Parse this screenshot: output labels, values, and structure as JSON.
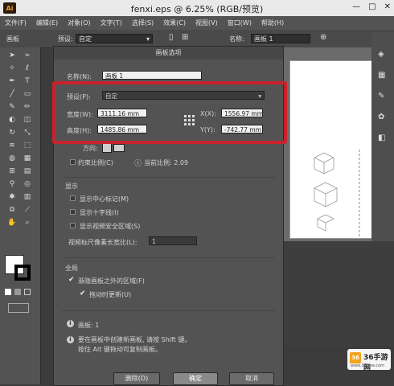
{
  "window": {
    "title": "fenxi.eps @ 6.25% (RGB/预览)",
    "app_logo": "Ai",
    "controls": [
      "—",
      "□",
      "✕"
    ]
  },
  "menu": [
    "文件(F)",
    "编辑(E)",
    "对象(O)",
    "文字(T)",
    "选择(S)",
    "效果(C)",
    "视图(V)",
    "窗口(W)",
    "帮助(H)"
  ],
  "control_bar": {
    "mode_label": "画板",
    "preset_label": "预设:",
    "preset_value": "自定",
    "name_label": "名称:",
    "name_value": "画板 1"
  },
  "dialog": {
    "title": "画板选项",
    "name_label": "名称(N):",
    "name_value": "画板 1",
    "preset_label": "预设(P):",
    "preset_value": "自定",
    "width_label": "宽度(W):",
    "width_value": "3111.16 mm",
    "height_label": "高度(H):",
    "height_value": "1485.86 mm",
    "x_label": "X(X):",
    "x_value": "1556.97 mm",
    "y_label": "Y(Y):",
    "y_value": "-742.77 mm",
    "orientation_label": "方向:",
    "constrain_label": "约束比例(C)",
    "current_ratio_label": "当前比例: 2.09",
    "display_section": "显示",
    "show_center": "显示中心标记(M)",
    "show_crosshairs": "显示十字线(I)",
    "show_video_safe": "显示视频安全区域(S)",
    "video_ruler_label": "视频标尺像素长宽比(L):",
    "video_ruler_value": "1",
    "global_section": "全局",
    "fade_outside": "渐隐画板之外的区域(F)",
    "update_drag": "拖动时更新(U)",
    "artboards_info": "画板: 1",
    "tip_line1": "要在画板中创建新画板, 请按 Shift 键。",
    "tip_line2": "按住 Alt 键拖动可复制画板。",
    "delete_label": "删除(D)",
    "ok_label": "确定",
    "cancel_label": "取消"
  },
  "watermark": {
    "brand": "36手游网",
    "url": "www.36ppw.com"
  }
}
